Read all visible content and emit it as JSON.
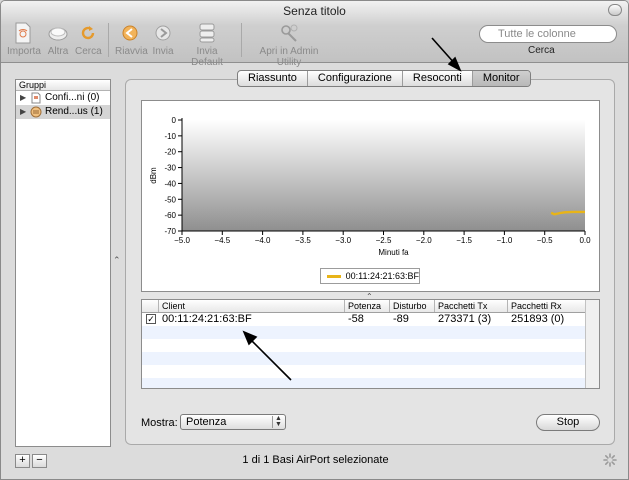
{
  "window": {
    "title": "Senza titolo"
  },
  "toolbar": {
    "importa": "Importa",
    "altra": "Altra",
    "cerca": "Cerca",
    "riavvia": "Riavvia",
    "invia": "Invia",
    "invia_default": "Invia Default",
    "apri_admin": "Apri in Admin Utility"
  },
  "search": {
    "placeholder": "Tutte le colonne",
    "label": "Cerca"
  },
  "sidebar": {
    "header": "Gruppi",
    "items": [
      {
        "label": "Confi...ni (0)",
        "icon": "document-icon",
        "selected": false
      },
      {
        "label": "Rend...us (1)",
        "icon": "rendezvous-icon",
        "selected": true
      }
    ]
  },
  "tabs": [
    {
      "label": "Riassunto",
      "active": false
    },
    {
      "label": "Configurazione",
      "active": false
    },
    {
      "label": "Resoconti",
      "active": false
    },
    {
      "label": "Monitor",
      "active": true
    }
  ],
  "chart_data": {
    "type": "line",
    "xlabel": "Minuti fa",
    "ylabel": "dBm",
    "xlim": [
      -5.0,
      0.0
    ],
    "ylim": [
      -70,
      0
    ],
    "xticks": [
      "-5.0",
      "-4.5",
      "-4.0",
      "-3.5",
      "-3.0",
      "-2.5",
      "-2.0",
      "-1.5",
      "-1.0",
      "-0.5",
      "0.0"
    ],
    "yticks": [
      "0",
      "-10",
      "-20",
      "-30",
      "-40",
      "-50",
      "-60",
      "-70"
    ],
    "grid": false,
    "series": [
      {
        "name": "00:11:24:21:63:BF",
        "color": "#e8b418",
        "x": [
          -0.42,
          -0.38,
          -0.32,
          -0.25,
          -0.15,
          -0.05,
          0.0
        ],
        "y": [
          -58.5,
          -59.5,
          -58.8,
          -58.2,
          -58.0,
          -58.0,
          -58.0
        ]
      }
    ]
  },
  "table": {
    "columns": [
      "",
      "Client",
      "Potenza",
      "Disturbo",
      "Pacchetti Tx",
      "Pacchetti Rx"
    ],
    "rows": [
      {
        "checked": true,
        "check_glyph": "✓",
        "client": "00:11:24:21:63:BF",
        "potenza": "-58",
        "disturbo": "-89",
        "tx": "273371 (3)",
        "rx": "251893 (0)"
      }
    ]
  },
  "mostra": {
    "label": "Mostra:",
    "value": "Potenza"
  },
  "stop_label": "Stop",
  "status": {
    "add": "+",
    "remove": "−",
    "text": "1 di 1 Basi AirPort selezionate"
  }
}
